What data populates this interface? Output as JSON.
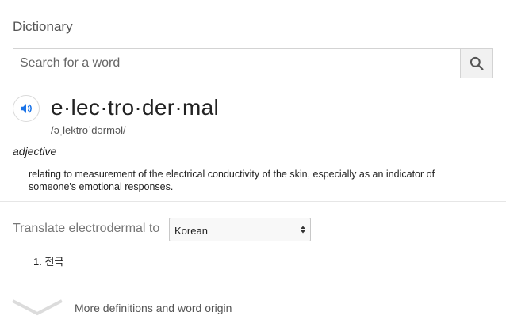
{
  "panel": {
    "title": "Dictionary"
  },
  "search": {
    "placeholder": "Search for a word",
    "value": "",
    "icon": "search-icon"
  },
  "entry": {
    "speaker_icon": "speaker-icon",
    "headword": "e·lec·tro·der·mal",
    "phonetic": "/əˌlektrōˈdərməl/",
    "part_of_speech": "adjective",
    "definitions": [
      "relating to measurement of the electrical conductivity of the skin, especially as an indicator of someone's emotional responses."
    ]
  },
  "translate": {
    "label": "Translate electrodermal to",
    "selected_language": "Korean",
    "results": [
      "1. 전극"
    ]
  },
  "footer": {
    "chevron_icon": "chevron-down-icon",
    "more_label": "More definitions and word origin"
  },
  "colors": {
    "speaker_blue": "#1a73e8",
    "divider": "#e6e6e6",
    "chevron": "#dcdcdc"
  }
}
